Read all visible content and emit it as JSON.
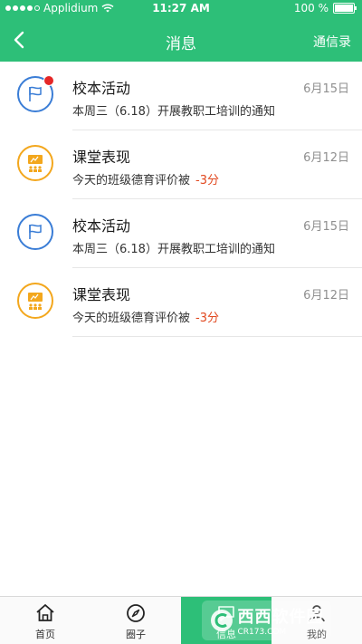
{
  "status_bar": {
    "carrier": "Applidium",
    "time": "11:27 AM",
    "battery": "100 %",
    "battery_level": 1.0,
    "signal_dots": 5,
    "signal_filled": 4
  },
  "nav": {
    "back_icon": "chevron-left-icon",
    "title": "消息",
    "right_action": "通信录"
  },
  "messages": [
    {
      "title": "校本活动",
      "date": "6月15日",
      "body": "本周三（6.18）开展教职工培训的通知",
      "score": "",
      "icon": "flag-icon",
      "icon_color": "#3a7dd6",
      "unread": true
    },
    {
      "title": "课堂表现",
      "date": "6月12日",
      "body": "今天的班级德育评价被",
      "score": "-3分",
      "icon": "classroom-icon",
      "icon_color": "#f3a71d",
      "unread": false
    },
    {
      "title": "校本活动",
      "date": "6月15日",
      "body": "本周三（6.18）开展教职工培训的通知",
      "score": "",
      "icon": "flag-icon",
      "icon_color": "#3a7dd6",
      "unread": false
    },
    {
      "title": "课堂表现",
      "date": "6月12日",
      "body": "今天的班级德育评价被",
      "score": "-3分",
      "icon": "classroom-icon",
      "icon_color": "#f3a71d",
      "unread": false
    }
  ],
  "tabbar": {
    "tabs": [
      {
        "label": "首页",
        "icon": "home-icon",
        "active": false
      },
      {
        "label": "圈子",
        "icon": "compass-icon",
        "active": false
      },
      {
        "label": "信息",
        "icon": "message-icon",
        "active": true
      },
      {
        "label": "我的",
        "icon": "user-icon",
        "active": false
      }
    ]
  },
  "watermark": {
    "text": "西西软件园",
    "sub": "CR173.COM"
  },
  "colors": {
    "brand": "#2dbf78",
    "unread_dot": "#e52727",
    "score": "#e1481f"
  }
}
